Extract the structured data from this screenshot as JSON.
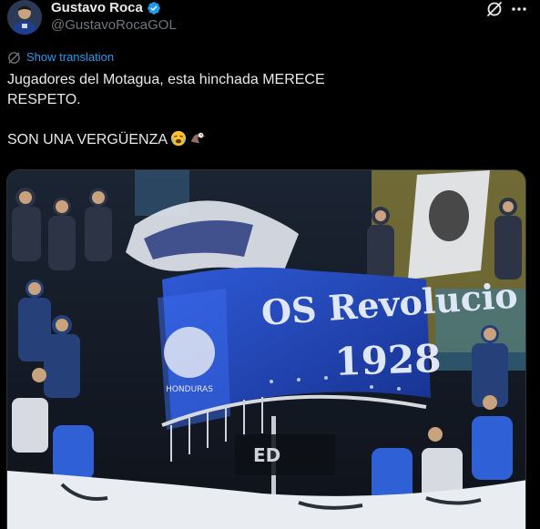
{
  "user": {
    "display_name": "Gustavo Roca",
    "handle": "@GustavoRocaGOL",
    "verified": true
  },
  "actions": {
    "grok_icon": "grok-icon",
    "more_icon": "more-options-icon"
  },
  "translation": {
    "label": "Show translation",
    "icon": "globe-icon"
  },
  "tweet": {
    "line1": "Jugadores del Motagua, esta hinchada MERECE",
    "line2": "RESPETO.",
    "line3": "SON UNA VERGÜENZA",
    "emojis": [
      "weary-face",
      "eagle"
    ]
  },
  "media": {
    "banner_line1": "OS Revolucio",
    "banner_line2": "1928",
    "banner_side": "HONDURAS",
    "barrier_text": "ED"
  },
  "colors": {
    "background": "#000000",
    "text": "#e7e9ea",
    "secondary": "#71767b",
    "link": "#1d9bf0",
    "verified": "#1d9bf0",
    "banner_blue": "#1c3fb0"
  }
}
